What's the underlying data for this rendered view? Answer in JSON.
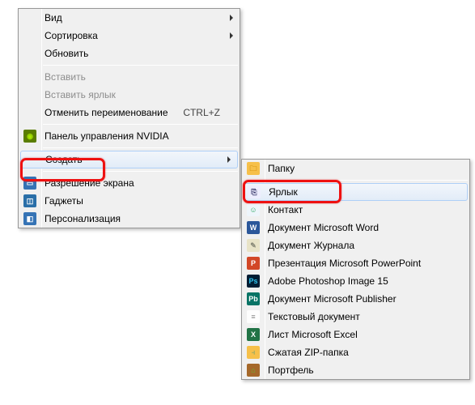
{
  "main": {
    "items": [
      {
        "label": "Вид",
        "arrow": true,
        "icon": null
      },
      {
        "label": "Сортировка",
        "arrow": true,
        "icon": null
      },
      {
        "label": "Обновить",
        "icon": null
      }
    ],
    "items2": [
      {
        "label": "Вставить",
        "disabled": true,
        "icon": null
      },
      {
        "label": "Вставить ярлык",
        "disabled": true,
        "icon": null
      },
      {
        "label": "Отменить переименование",
        "shortcut": "CTRL+Z",
        "icon": null
      }
    ],
    "nvidia": {
      "label": "Панель управления NVIDIA"
    },
    "create": {
      "label": "Создать"
    },
    "items3": [
      {
        "label": "Разрешение экрана",
        "icon": "monitor"
      },
      {
        "label": "Гаджеты",
        "icon": "gadget"
      },
      {
        "label": "Персонализация",
        "icon": "personalize"
      }
    ]
  },
  "sub": [
    {
      "label": "Папку",
      "icon": "folder",
      "group": 0
    },
    {
      "label": "Ярлык",
      "icon": "shortcut",
      "group": 1,
      "hover": true
    },
    {
      "label": "Контакт",
      "icon": "contact",
      "group": 1
    },
    {
      "label": "Документ Microsoft Word",
      "icon": "word",
      "group": 1
    },
    {
      "label": "Документ Журнала",
      "icon": "journal",
      "group": 1
    },
    {
      "label": "Презентация Microsoft PowerPoint",
      "icon": "ppt",
      "group": 1
    },
    {
      "label": "Adobe Photoshop Image 15",
      "icon": "ps",
      "group": 1
    },
    {
      "label": "Документ Microsoft Publisher",
      "icon": "pub",
      "group": 1
    },
    {
      "label": "Текстовый документ",
      "icon": "txt",
      "group": 1
    },
    {
      "label": "Лист Microsoft Excel",
      "icon": "excel",
      "group": 1
    },
    {
      "label": "Сжатая ZIP-папка",
      "icon": "zip",
      "group": 1
    },
    {
      "label": "Портфель",
      "icon": "briefcase",
      "group": 1
    }
  ],
  "icons": {
    "nvidia": {
      "bg": "#5a7d00",
      "fg": "#a6e600",
      "ch": "◉"
    },
    "monitor": {
      "bg": "#3573b5",
      "fg": "#fff",
      "ch": "▭"
    },
    "gadget": {
      "bg": "#2a6fa8",
      "fg": "#fff",
      "ch": "◫"
    },
    "personalize": {
      "bg": "#3573b5",
      "fg": "#fff",
      "ch": "◧"
    },
    "folder": {
      "bg": "#f6c04a",
      "fg": "#d99a17",
      "ch": "🗀"
    },
    "shortcut": {
      "bg": "#eef",
      "fg": "#336",
      "ch": "⎘"
    },
    "contact": {
      "bg": "#eef5fb",
      "fg": "#3a6",
      "ch": "☺"
    },
    "word": {
      "bg": "#2b579a",
      "fg": "#fff",
      "ch": "W"
    },
    "journal": {
      "bg": "#e8e3c7",
      "fg": "#887",
      "ch": "✎"
    },
    "ppt": {
      "bg": "#d24726",
      "fg": "#fff",
      "ch": "P"
    },
    "ps": {
      "bg": "#001d34",
      "fg": "#31c5f0",
      "ch": "Ps"
    },
    "pub": {
      "bg": "#087365",
      "fg": "#fff",
      "ch": "Pb"
    },
    "txt": {
      "bg": "#fdfdfd",
      "fg": "#888",
      "ch": "≡"
    },
    "excel": {
      "bg": "#217346",
      "fg": "#fff",
      "ch": "X"
    },
    "zip": {
      "bg": "#f6c04a",
      "fg": "#9a6",
      "ch": "⫞"
    },
    "briefcase": {
      "bg": "#a5682a",
      "fg": "#6b3",
      "ch": "⌂"
    }
  }
}
